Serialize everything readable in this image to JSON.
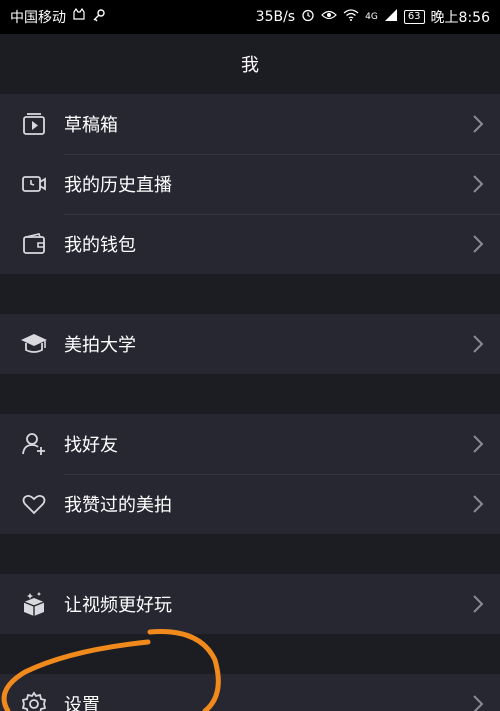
{
  "status_bar": {
    "carrier": "中国移动",
    "speed": "35B/s",
    "network": "4G",
    "battery": "63",
    "time": "晚上8:56"
  },
  "header": {
    "title": "我"
  },
  "groups": [
    {
      "items": [
        {
          "label": "草稿箱",
          "icon": "drafts-play-icon"
        },
        {
          "label": "我的历史直播",
          "icon": "video-camera-icon"
        },
        {
          "label": "我的钱包",
          "icon": "wallet-icon"
        }
      ]
    },
    {
      "items": [
        {
          "label": "美拍大学",
          "icon": "graduation-cap-icon"
        }
      ]
    },
    {
      "items": [
        {
          "label": "找好友",
          "icon": "add-friend-icon"
        },
        {
          "label": "我赞过的美拍",
          "icon": "heart-icon"
        }
      ]
    },
    {
      "items": [
        {
          "label": "让视频更好玩",
          "icon": "magic-box-icon"
        }
      ]
    },
    {
      "items": [
        {
          "label": "设置",
          "icon": "gear-icon"
        }
      ]
    }
  ],
  "colors": {
    "background": "#242430",
    "row": "#272732",
    "header": "#1c1c23",
    "annotation": "#f08a1c"
  }
}
